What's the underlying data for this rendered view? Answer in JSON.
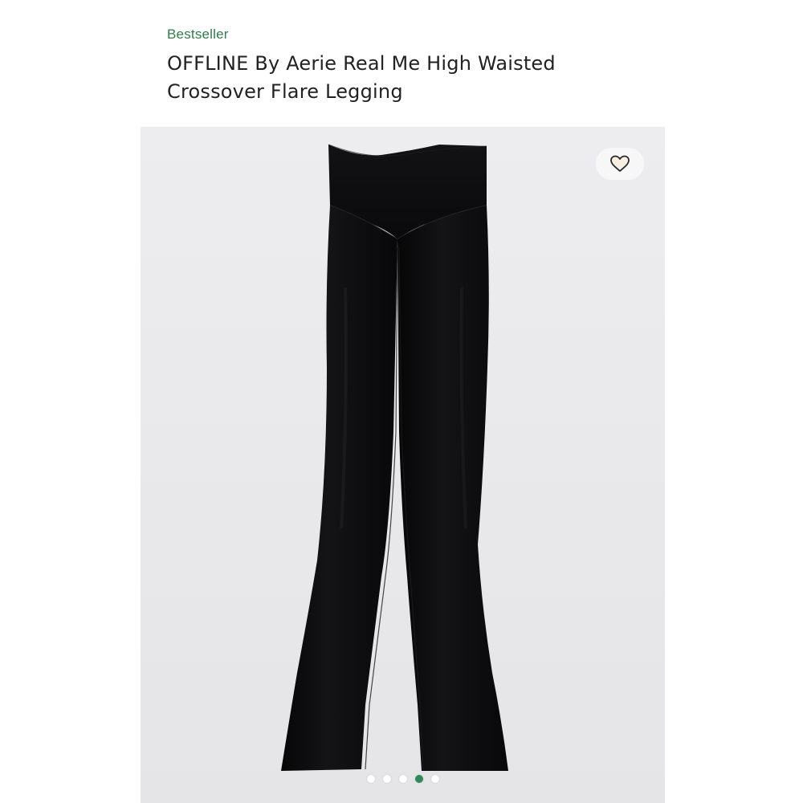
{
  "product": {
    "badge": "Bestseller",
    "title": "OFFLINE By Aerie Real Me High Waisted Crossover Flare Legging"
  },
  "gallery": {
    "image_description_icon": "black-flare-leggings-image",
    "favorite_icon": "heart-outline-icon",
    "total_slides": 5,
    "active_slide": 4
  },
  "colors": {
    "accent": "#2e7d4a",
    "active_dot": "#2e8b57",
    "background": "#e9e9eb",
    "product": "#0d0d0f"
  }
}
